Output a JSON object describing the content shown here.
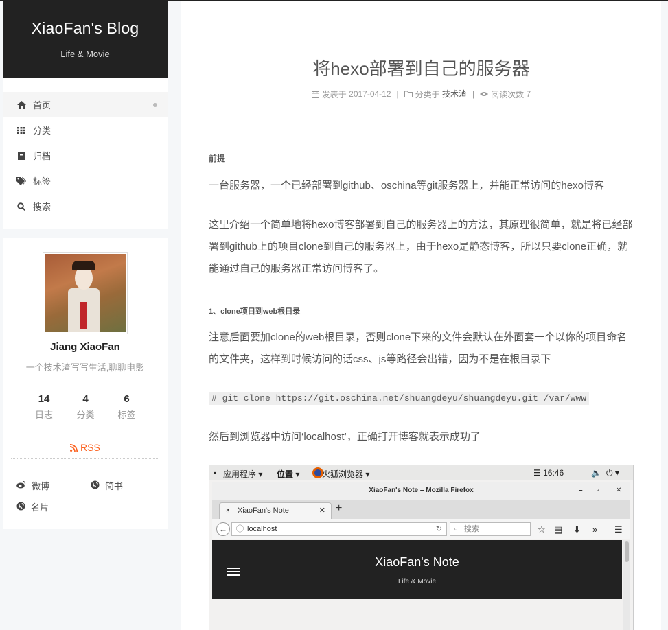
{
  "site": {
    "title": "XiaoFan's Blog",
    "subtitle": "Life & Movie"
  },
  "menu": [
    {
      "label": "首页",
      "icon": "home-icon"
    },
    {
      "label": "分类",
      "icon": "grid-icon"
    },
    {
      "label": "归档",
      "icon": "archive-icon"
    },
    {
      "label": "标签",
      "icon": "tags-icon"
    },
    {
      "label": "搜索",
      "icon": "search-icon"
    }
  ],
  "profile": {
    "name": "Jiang XiaoFan",
    "description": "一个技术渣写写生活,聊聊电影",
    "stats": [
      {
        "count": "14",
        "label": "日志"
      },
      {
        "count": "4",
        "label": "分类"
      },
      {
        "count": "6",
        "label": "标签"
      }
    ],
    "rss": "RSS",
    "links": [
      {
        "label": "微博",
        "icon": "weibo-icon"
      },
      {
        "label": "简书",
        "icon": "globe-icon"
      },
      {
        "label": "名片",
        "icon": "globe-icon"
      }
    ]
  },
  "post": {
    "title": "将hexo部署到自己的服务器",
    "meta": {
      "posted_prefix": "发表于",
      "posted_date": "2017-04-12",
      "category_prefix": "分类于",
      "category": "技术渣",
      "views_prefix": "阅读次数",
      "views": "7",
      "separator": "|"
    },
    "h_preface": "前提",
    "p1": "一台服务器，一个已经部署到github、oschina等git服务器上，并能正常访问的hexo博客",
    "p2": "这里介绍一个简单地将hexo博客部署到自己的服务器上的方法，其原理很简单，就是将已经部署到github上的项目clone到自己的服务器上，由于hexo是静态博客，所以只要clone正确，就能通过自己的服务器正常访问博客了。",
    "h_step1": "1、clone项目到web根目录",
    "p3": "注意后面要加clone的web根目录，否则clone下来的文件会默认在外面套一个以你的项目命名的文件夹，这样到时候访问的话css、js等路径会出错，因为不是在根目录下",
    "code": "# git clone https://git.oschina.net/shuangdeyu/shuangdeyu.git /var/www",
    "p4": "然后到浏览器中访问‘localhost’，正确打开博客就表示成功了"
  },
  "screenshot": {
    "apps": "应用程序 ▾",
    "places": "位置 ▾",
    "browser": "火狐浏览器 ▾",
    "clock": "☰ 16:46",
    "window_title": "XiaoFan's Note – Mozilla Firefox",
    "tab_label": "XiaoFan's Note",
    "url": "localhost",
    "search_placeholder": "搜索",
    "site_title": "XiaoFan's Note",
    "site_subtitle": "Life & Movie"
  }
}
